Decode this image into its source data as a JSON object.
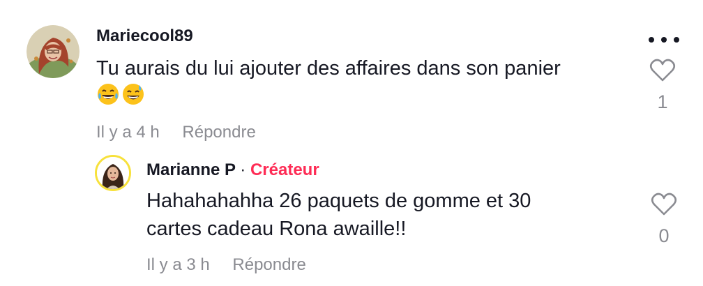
{
  "comment": {
    "username": "Mariecool89",
    "text": "Tu aurais du lui ajouter des affaires dans son panier",
    "emojis": [
      "😂",
      "😅"
    ],
    "time": "Il y a 4 h",
    "reply_label": "Répondre",
    "like_count": "1",
    "avatar_icon": "user-avatar-icon",
    "more_icon": "more-dots-icon"
  },
  "reply": {
    "username": "Marianne P",
    "separator": "·",
    "badge": "Créateur",
    "text_line1": "Hahahahahha 26 paquets de gomme et 30",
    "text_line2": "cartes cadeau Rona awaille!!",
    "time": "Il y a 3 h",
    "reply_label": "Répondre",
    "like_count": "0",
    "avatar_ring_color": "#f7e13b"
  },
  "colors": {
    "text_primary": "#161823",
    "text_secondary": "#8a8b91",
    "creator": "#fe2c55"
  }
}
